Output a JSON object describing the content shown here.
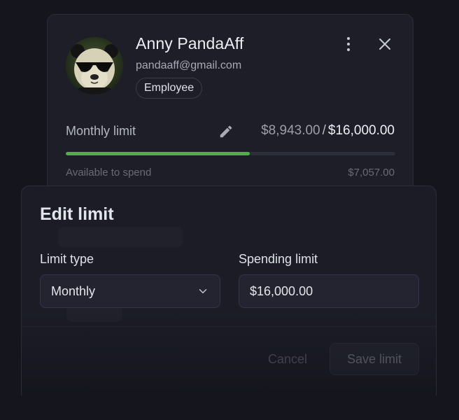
{
  "user": {
    "name": "Anny PandaAff",
    "email": "pandaaff@gmail.com",
    "role": "Employee"
  },
  "limit": {
    "label": "Monthly limit",
    "spent": "$8,943.00",
    "separator": "/",
    "total": "$16,000.00",
    "progress_fraction": 0.559,
    "available_label": "Available to spend",
    "available_value": "$7,057.00"
  },
  "edit_modal": {
    "title": "Edit limit",
    "limit_type_label": "Limit type",
    "limit_type_value": "Monthly",
    "spending_limit_label": "Spending limit",
    "spending_limit_value": "$16,000.00",
    "cancel_label": "Cancel",
    "save_label": "Save limit"
  },
  "icons": {
    "more": "more-vertical-icon",
    "close": "close-icon",
    "edit": "pencil-icon",
    "dropdown": "chevron-down-icon"
  },
  "colors": {
    "progress": "#4fb043",
    "background": "#14151d",
    "card": "#1d1e28"
  }
}
